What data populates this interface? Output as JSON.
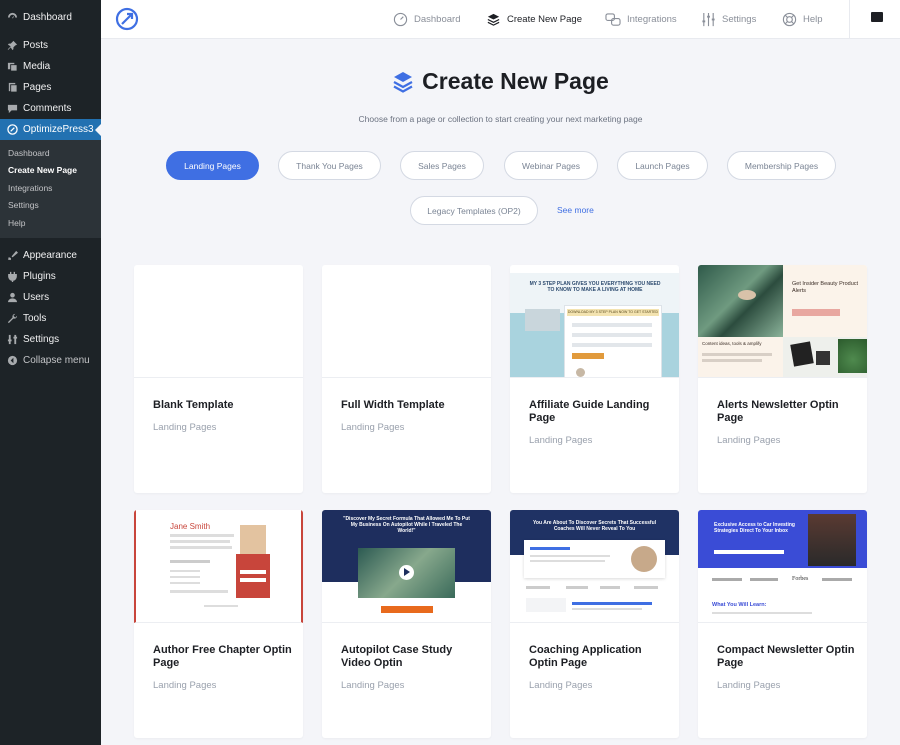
{
  "sidebar": {
    "top_items": [
      {
        "label": "Dashboard",
        "icon": "dashboard-icon"
      },
      {
        "label": "Posts",
        "icon": "pin-icon"
      },
      {
        "label": "Media",
        "icon": "media-icon"
      },
      {
        "label": "Pages",
        "icon": "page-icon"
      },
      {
        "label": "Comments",
        "icon": "comment-icon"
      },
      {
        "label": "OptimizePress3",
        "icon": "optimizepress-icon"
      }
    ],
    "sub_items": [
      "Dashboard",
      "Create New Page",
      "Integrations",
      "Settings",
      "Help"
    ],
    "bottom_items": [
      {
        "label": "Appearance",
        "icon": "brush-icon"
      },
      {
        "label": "Plugins",
        "icon": "plug-icon"
      },
      {
        "label": "Users",
        "icon": "user-icon"
      },
      {
        "label": "Tools",
        "icon": "wrench-icon"
      },
      {
        "label": "Settings",
        "icon": "sliders-icon"
      },
      {
        "label": "Collapse menu",
        "icon": "collapse-icon"
      }
    ]
  },
  "topnav": {
    "items": [
      "Dashboard",
      "Create New Page",
      "Integrations",
      "Settings",
      "Help"
    ],
    "active": "Create New Page"
  },
  "header": {
    "title": "Create New Page",
    "subtitle": "Choose from a page or collection to start creating your next marketing page"
  },
  "filters": {
    "pills": [
      "Landing Pages",
      "Thank You Pages",
      "Sales Pages",
      "Webinar Pages",
      "Launch Pages",
      "Membership Pages",
      "Legacy Templates (OP2)"
    ],
    "active": "Landing Pages",
    "see_more": "See more"
  },
  "templates": [
    {
      "name": "Blank Template",
      "category": "Landing Pages"
    },
    {
      "name": "Full Width Template",
      "category": "Landing Pages"
    },
    {
      "name": "Affiliate Guide Landing Page",
      "category": "Landing Pages"
    },
    {
      "name": "Alerts Newsletter Optin Page",
      "category": "Landing Pages"
    },
    {
      "name": "Author Free Chapter Optin Page",
      "category": "Landing Pages"
    },
    {
      "name": "Autopilot Case Study Video Optin",
      "category": "Landing Pages"
    },
    {
      "name": "Coaching Application Optin Page",
      "category": "Landing Pages"
    },
    {
      "name": "Compact Newsletter Optin Page",
      "category": "Landing Pages"
    }
  ],
  "thumbnails": {
    "affiliate": {
      "headline": "MY 3 STEP PLAN GIVES YOU EVERYTHING YOU NEED TO KNOW TO MAKE A LIVING AT HOME",
      "cta": "DOWNLOAD MY 3 STEP PLAN NOW TO GET STARTED"
    },
    "alerts": {
      "headline": "Get Insider Beauty Product Alerts",
      "subhead": "Content ideas, tools & amplify"
    },
    "author": {
      "name": "Jane Smith"
    },
    "autopilot": {
      "headline": "\"Discover My Secret Formula That Allowed Me To Put My Business On Autopilot While I Traveled The World!\""
    },
    "coaching": {
      "headline": "You Are About To Discover Secrets That Successful Coaches Will Never Reveal To You",
      "brand": "Forbes"
    },
    "compact": {
      "headline": "Exclusive Access to Car Investing Strategies Direct To Your Inbox",
      "section": "What You Will Learn:",
      "brand": "Forbes"
    }
  },
  "colors": {
    "accent": "#3f6fe3",
    "wp_sidebar": "#1d2327",
    "wp_active": "#2271b1"
  }
}
